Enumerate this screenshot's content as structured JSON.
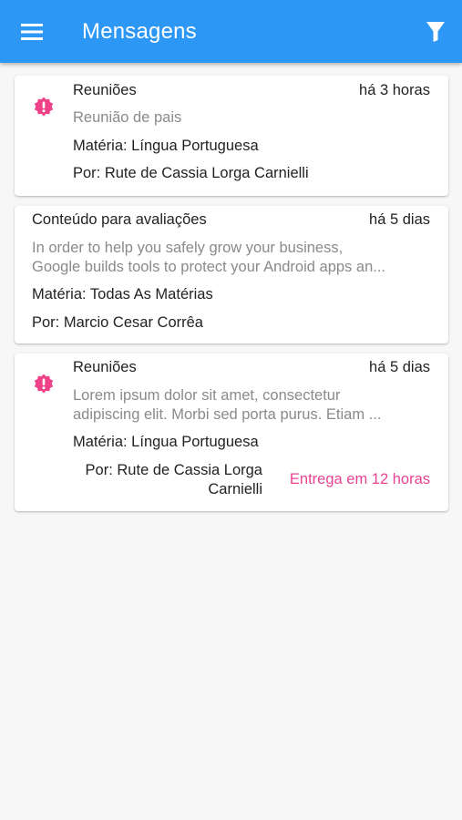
{
  "appbar": {
    "title": "Mensagens",
    "background": "#2d97f5",
    "menu_icon": "hamburger-menu-icon",
    "filter_icon": "filter-funnel-icon"
  },
  "messages": [
    {
      "important": true,
      "subject": "Reuniões",
      "time": "há 3 horas",
      "preview_lines": [
        "Reunião de pais"
      ],
      "subject_line": "Matéria: Língua Portuguesa",
      "author_line": "Por: Rute de Cassia Lorga Carnielli"
    },
    {
      "important": false,
      "subject": "Conteúdo para avaliações",
      "time": "há 5 dias",
      "preview_lines": [
        "In order to help you safely grow your business,",
        "Google builds tools to protect your Android apps an..."
      ],
      "subject_line": "Matéria: Todas As Matérias",
      "author_line": "Por: Marcio Cesar Corrêa"
    },
    {
      "important": true,
      "subject": "Reuniões",
      "time": "há 5 dias",
      "preview_lines": [
        "Lorem ipsum dolor sit amet, consectetur",
        "adipiscing elit. Morbi sed porta purus. Etiam ..."
      ],
      "subject_line": "Matéria: Língua Portuguesa",
      "author_lines": [
        "Por: Rute de Cassia Lorga",
        "Carnielli"
      ],
      "deadline": "Entrega em 12 horas"
    }
  ],
  "colors": {
    "important_icon": "#f0418b",
    "deadline": "#e84393",
    "preview": "#8a8a8a"
  },
  "important_icon_name": "alert-badge-icon"
}
